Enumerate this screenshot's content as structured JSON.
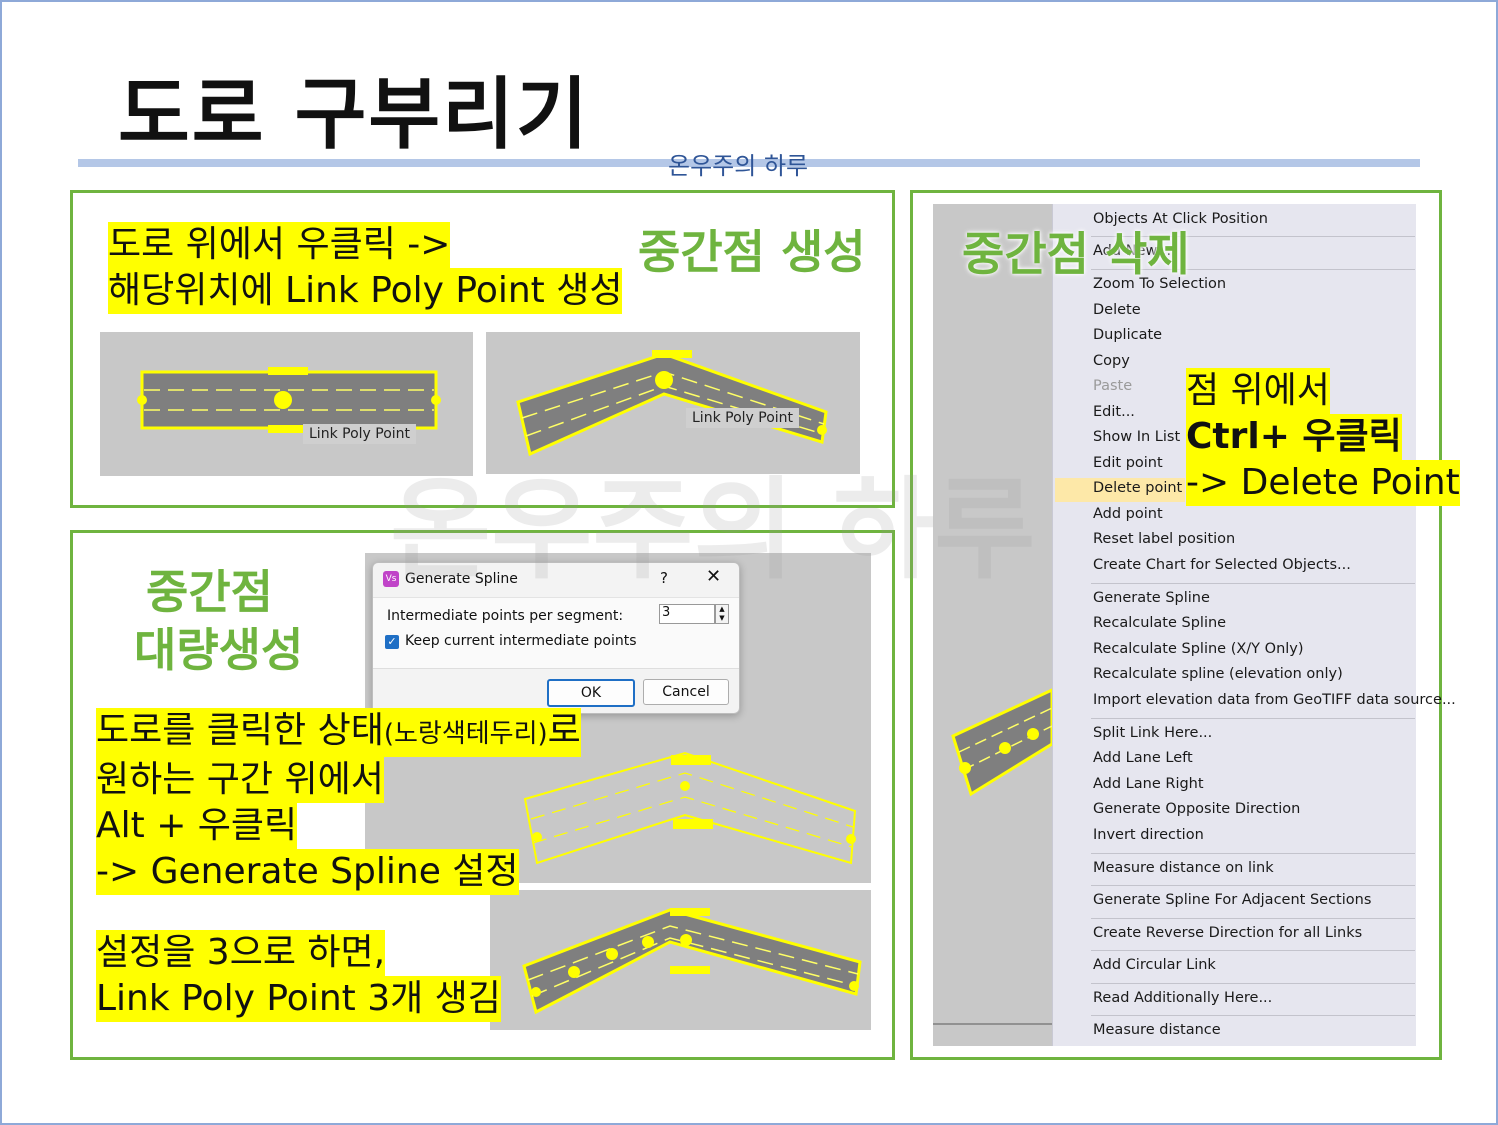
{
  "title": "도로 구부리기",
  "divider_text": "온우주의 하루",
  "watermark": "온우주의 하루",
  "section1": {
    "heading": "중간점 생성",
    "lines": [
      "도로 위에서 우클릭 ->",
      "해당위치에 Link Poly Point 생성"
    ],
    "label_a": "Link Poly Point",
    "label_b": "Link Poly Point"
  },
  "section2": {
    "heading_line1": "중간점",
    "heading_line2": "대량생성",
    "line1_main": "도로를 클릭한 상태",
    "line1_paren": "(노랑색테두리)",
    "line1_end": "로",
    "line2": "원하는 구간 위에서",
    "line3": "Alt + 우클릭",
    "line4": "-> Generate Spline 설정",
    "line5": "설정을 3으로 하면,",
    "line6": "Link Poly Point 3개 생김"
  },
  "dialog": {
    "title": "Generate Spline",
    "icon_text": "Vs",
    "help": "?",
    "close": "✕",
    "field_label": "Intermediate points per segment:",
    "field_value": "3",
    "checkbox_label": "Keep current intermediate points",
    "checkbox_checked": true,
    "ok": "OK",
    "cancel": "Cancel"
  },
  "section3": {
    "heading": "중간점 삭제",
    "line1": "점 위에서",
    "line2": "Ctrl+ 우클릭",
    "line3": "-> Delete Point"
  },
  "menu": {
    "items": [
      "Objects At Click Position",
      "Add New ...",
      "Zoom To Selection",
      "Delete",
      "Duplicate",
      "Copy",
      "Paste",
      "Edit...",
      "Show In List",
      "Edit point",
      "Delete point",
      "Add point",
      "Reset label position",
      "Create Chart for Selected Objects...",
      "Generate Spline",
      "Recalculate Spline",
      "Recalculate Spline (X/Y Only)",
      "Recalculate spline (elevation only)",
      "Import elevation data from GeoTIFF data source...",
      "Split Link Here...",
      "Add Lane Left",
      "Add Lane Right",
      "Generate Opposite Direction",
      "Invert direction",
      "Measure distance on link",
      "Generate Spline For Adjacent Sections",
      "Create Reverse Direction for all Links",
      "Add Circular Link",
      "Read Additionally Here...",
      "Measure distance"
    ],
    "highlighted": "Delete point",
    "disabled": "Paste"
  },
  "colors": {
    "highlight": "#ffff00",
    "green": "#6fb43f",
    "divider": "#b4c7e7",
    "road": "#808080",
    "canvas": "#c8c8c8"
  }
}
